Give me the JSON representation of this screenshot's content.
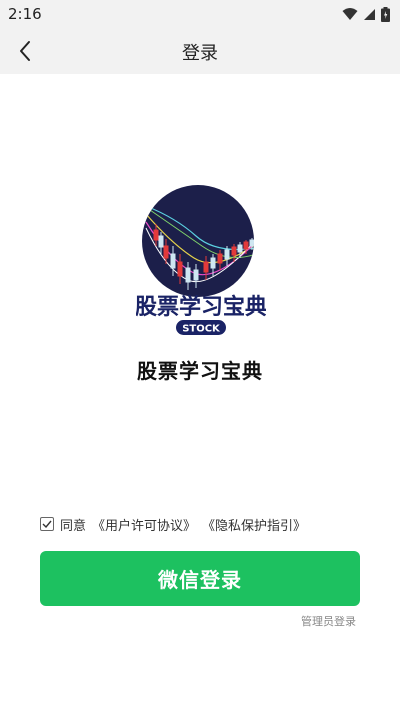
{
  "status_bar": {
    "time": "2:16"
  },
  "nav": {
    "title": "登录"
  },
  "logo": {
    "title": "股票学习宝典",
    "badge": "STOCK"
  },
  "app_name": "股票学习宝典",
  "agreement": {
    "prefix": "同意",
    "user_agreement": "《用户许可协议》",
    "privacy": "《隐私保护指引》",
    "checked": true
  },
  "buttons": {
    "wechat_login": "微信登录",
    "admin_login": "管理员登录"
  },
  "colors": {
    "primary": "#1dc160",
    "bar_bg": "#f2f2f2",
    "logo_bg": "#1c1f4a"
  }
}
